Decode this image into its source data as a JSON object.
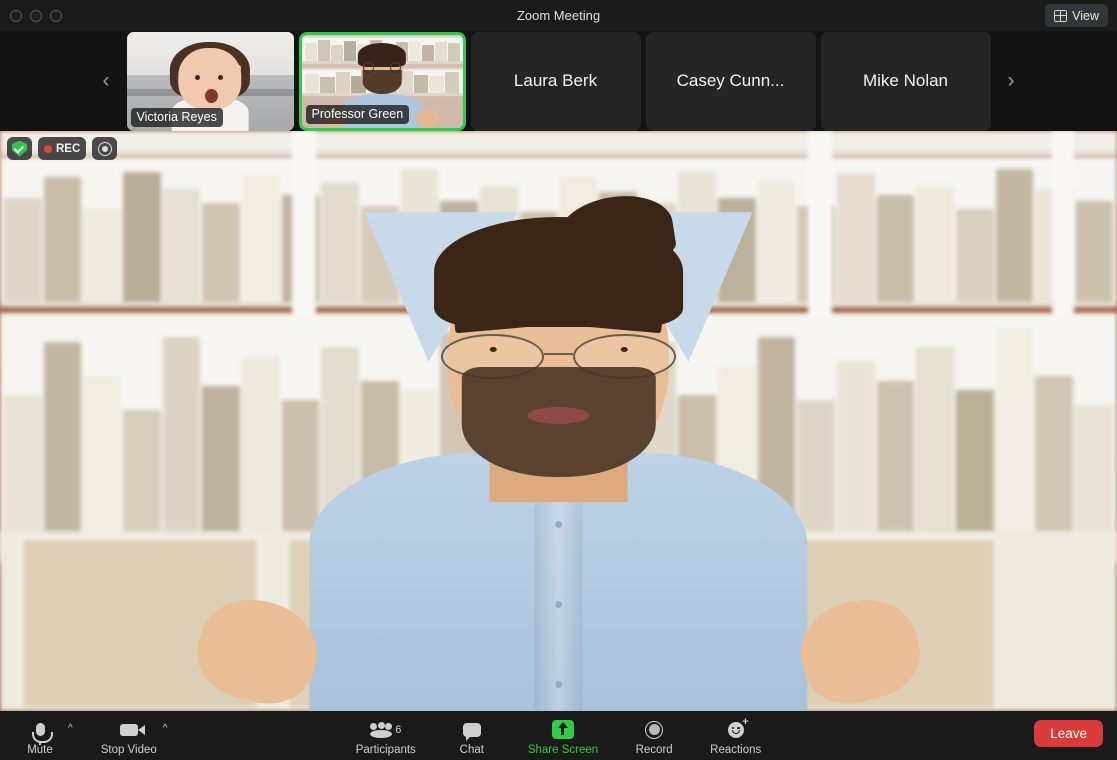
{
  "window": {
    "title": "Zoom Meeting",
    "traffic_lights": [
      "close",
      "minimize",
      "maximize"
    ]
  },
  "header": {
    "view_button_label": "View",
    "view_icon": "grid-icon"
  },
  "filmstrip": {
    "prev_arrow": "‹",
    "next_arrow": "›",
    "thumbnails": [
      {
        "name": "Victoria Reyes",
        "video_on": true,
        "active_speaker": false
      },
      {
        "name": "Professor Green",
        "video_on": true,
        "active_speaker": true
      },
      {
        "name": "Laura Berk",
        "video_on": false,
        "active_speaker": false
      },
      {
        "name": "Casey Cunn...",
        "video_on": false,
        "active_speaker": false
      },
      {
        "name": "Mike Nolan",
        "video_on": false,
        "active_speaker": false
      }
    ]
  },
  "stage": {
    "badges": [
      {
        "id": "encryption-badge",
        "icon": "shield-check-icon",
        "label": ""
      },
      {
        "id": "recording-badge",
        "icon": "record-dot-icon",
        "label": "REC"
      },
      {
        "id": "recording-control-badge",
        "icon": "record-circle-icon",
        "label": ""
      }
    ],
    "speaker_name": "Professor Green"
  },
  "toolbar": {
    "mute": {
      "label": "Mute",
      "icon": "microphone-icon",
      "caret": "^"
    },
    "video": {
      "label": "Stop Video",
      "icon": "camera-icon",
      "caret": "^"
    },
    "participants": {
      "label": "Participants",
      "icon": "people-icon",
      "count": "6"
    },
    "chat": {
      "label": "Chat",
      "icon": "chat-bubble-icon"
    },
    "share": {
      "label": "Share Screen",
      "icon": "share-screen-icon",
      "color": "#2ecc4a"
    },
    "record": {
      "label": "Record",
      "icon": "record-circle-icon"
    },
    "reactions": {
      "label": "Reactions",
      "icon": "smiley-plus-icon"
    },
    "leave": {
      "label": "Leave",
      "color": "#d93a3a"
    }
  },
  "colors": {
    "accent_green": "#2ecc4a",
    "leave_red": "#d93a3a",
    "rec_red": "#e8453c",
    "chrome_dark": "#1a1a1a",
    "filmstrip_bg": "#131313"
  }
}
